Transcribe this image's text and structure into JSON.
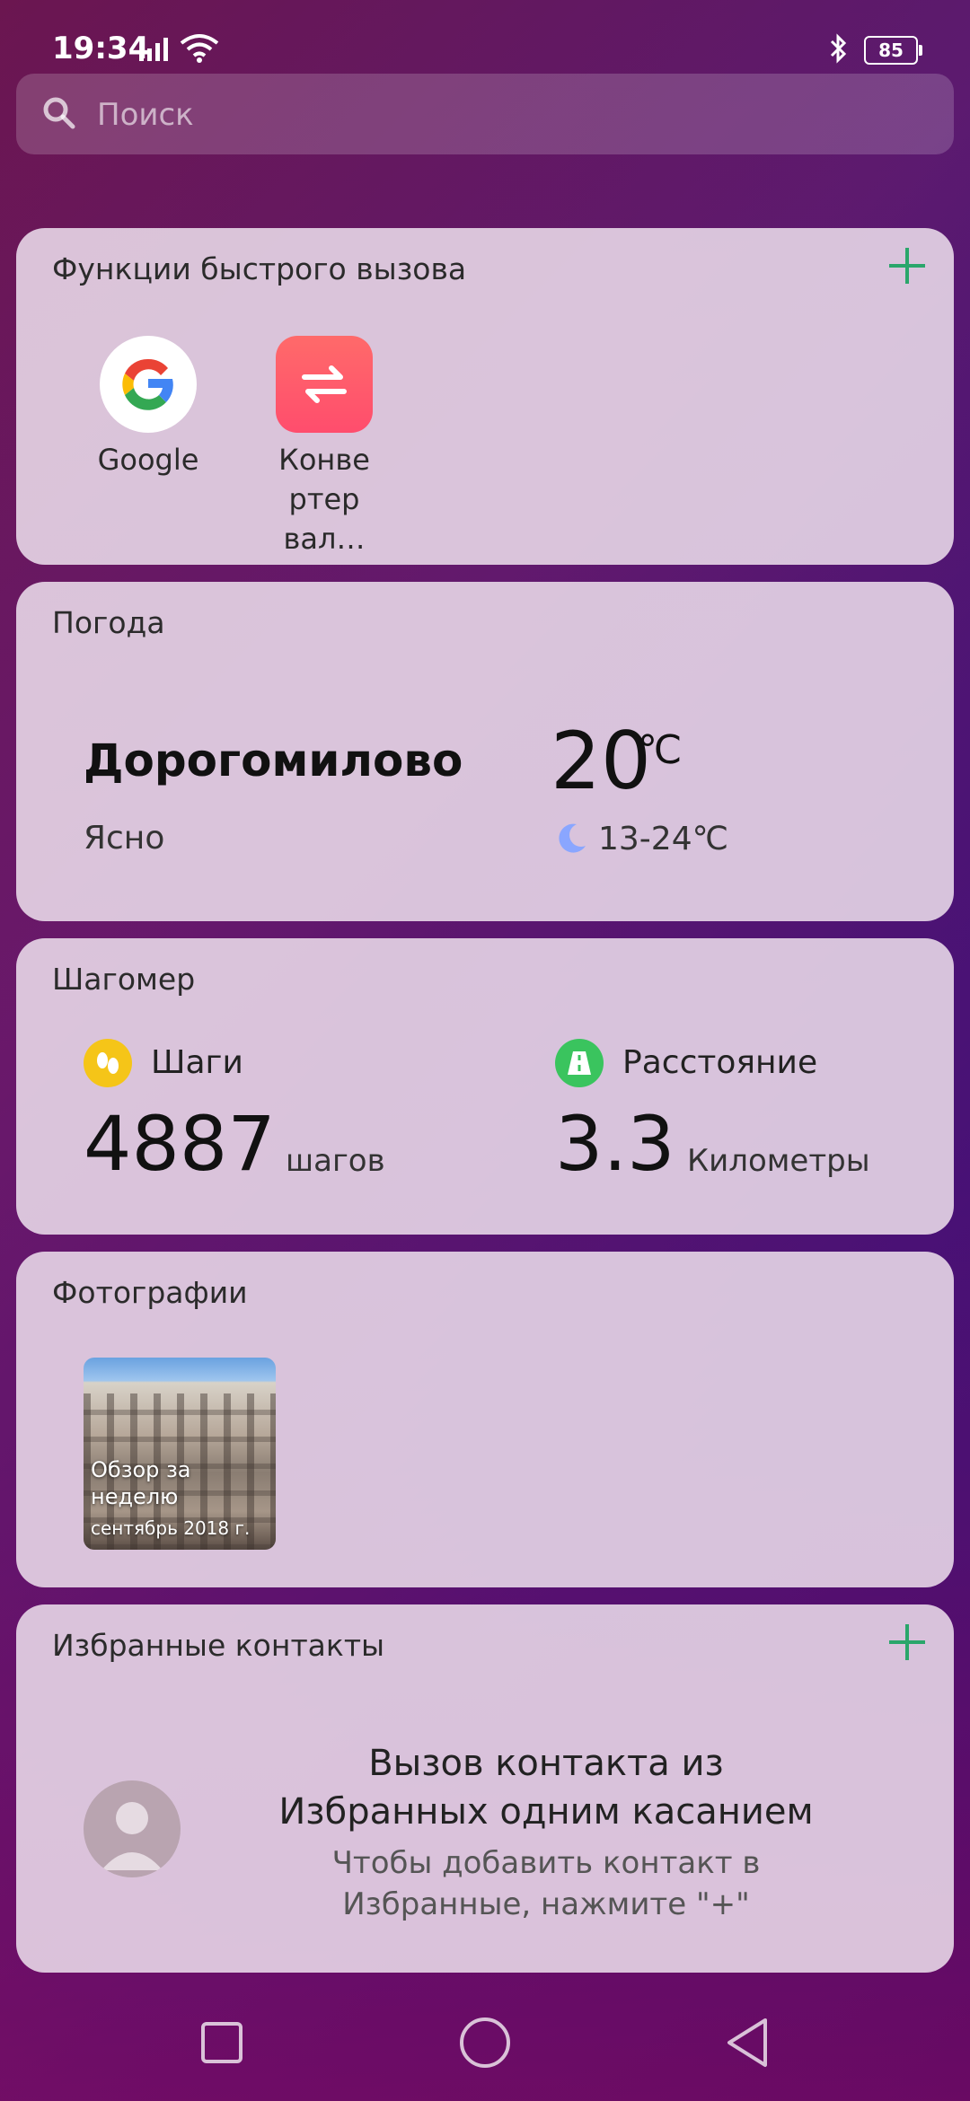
{
  "status_bar": {
    "time": "19:34",
    "battery": "85"
  },
  "search": {
    "placeholder": "Поиск"
  },
  "quick_functions": {
    "title": "Функции быстрого вызова",
    "apps": [
      {
        "label": "Google",
        "icon": "google-icon"
      },
      {
        "label": "Конве ртер вал…",
        "icon": "currency-converter-icon"
      }
    ]
  },
  "weather": {
    "title": "Погода",
    "city": "Дорогомилово",
    "condition": "Ясно",
    "temperature": "20",
    "unit": "℃",
    "range": "13-24℃",
    "icon": "moon-icon"
  },
  "pedometer": {
    "title": "Шагомер",
    "steps_label": "Шаги",
    "steps_value": "4887",
    "steps_unit": "шагов",
    "distance_label": "Расстояние",
    "distance_value": "3.3",
    "distance_unit": "Километры"
  },
  "photos": {
    "title": "Фотографии",
    "caption": "Обзор за неделю",
    "date": "сентябрь 2018 г."
  },
  "favorites": {
    "title": "Избранные контакты",
    "main_line1": "Вызов контакта из",
    "main_line2": "Избранных одним касанием",
    "sub_line1": "Чтобы добавить контакт в",
    "sub_line2": "Избранные, нажмите \"+\""
  },
  "colors": {
    "accent_green": "#2aa66b",
    "converter": "#ff5a6a"
  }
}
